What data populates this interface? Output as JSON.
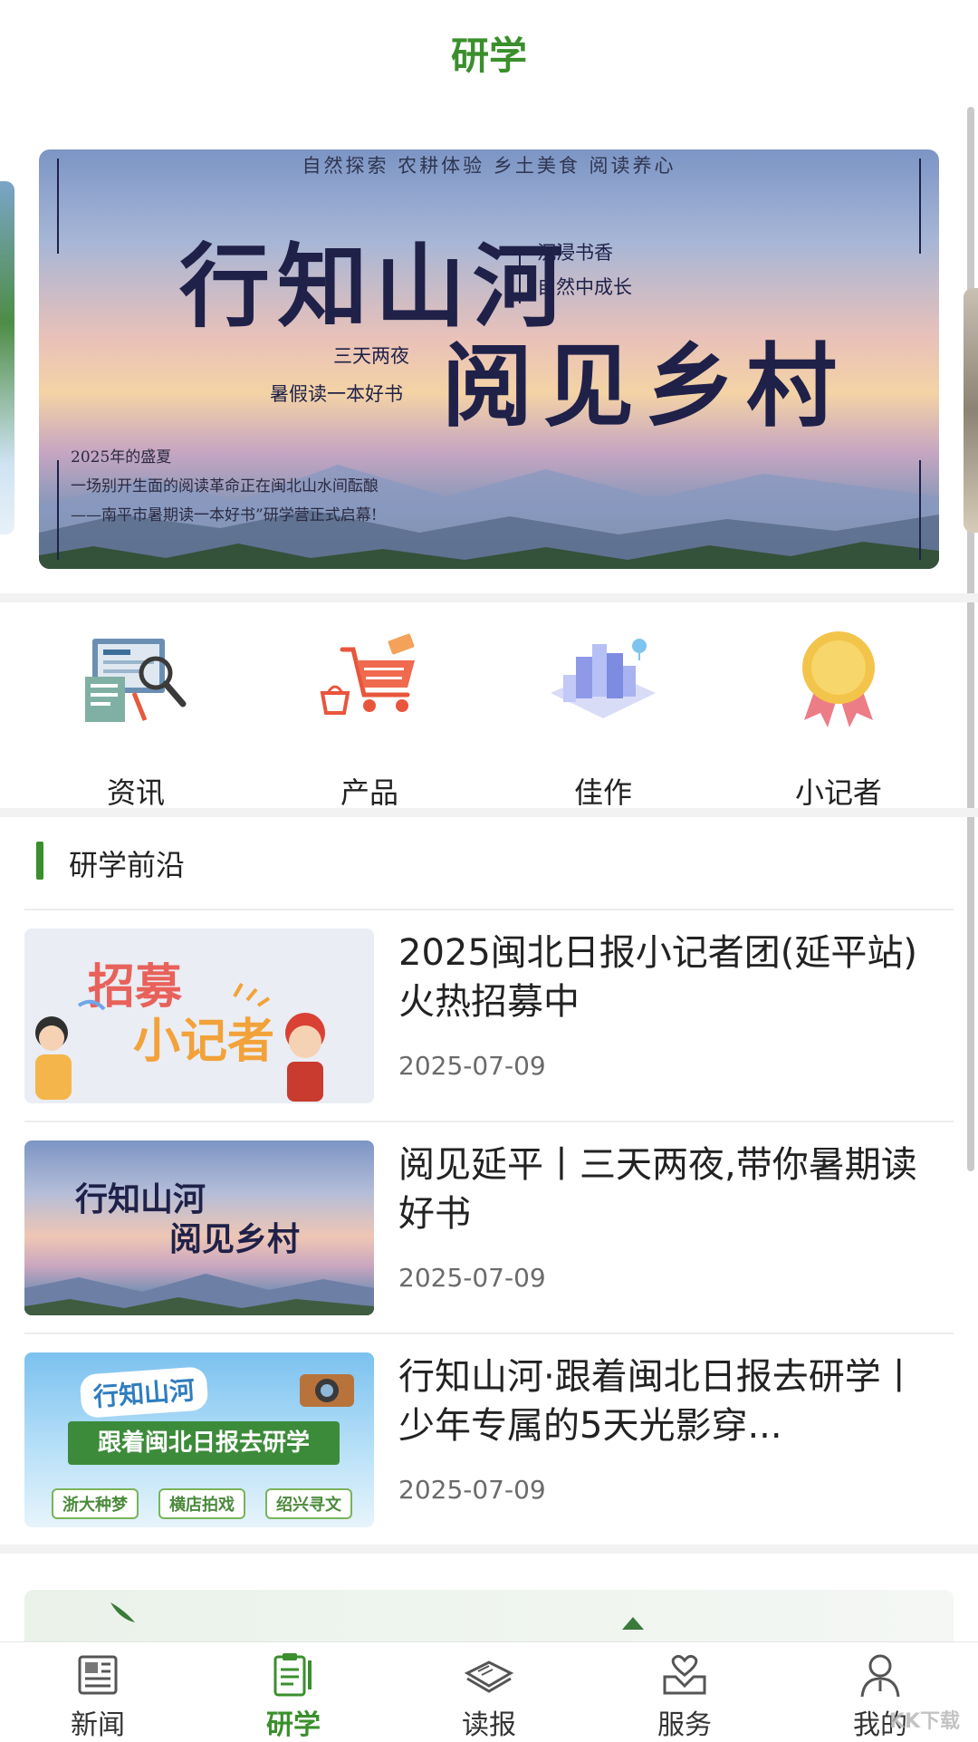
{
  "header": {
    "title": "研学"
  },
  "banner": {
    "tags": "自然探索  农耕体验  乡土美食  阅读养心",
    "title_line1": "行知山河",
    "sub1": "沉浸书香",
    "sub2": "自然中成长",
    "side1": "三天两夜",
    "side2": "暑假读一本好书",
    "title_line2": "阅见乡村",
    "foot1": "2025年的盛夏",
    "foot2": "一场别开生面的阅读革命正在闽北山水间酝酿",
    "foot3": "——南平市暑期读一本好书”研学营正式启幕!"
  },
  "quick_links": [
    {
      "label": "资讯",
      "icon": "news-document-icon"
    },
    {
      "label": "产品",
      "icon": "shopping-cart-icon"
    },
    {
      "label": "佳作",
      "icon": "city-buildings-icon"
    },
    {
      "label": "小记者",
      "icon": "medal-icon"
    }
  ],
  "section": {
    "title": "研学前沿"
  },
  "news": [
    {
      "title": "2025闽北日报小记者团(延平站)火热招募中",
      "date": "2025-07-09",
      "thumb": {
        "line1": "招募",
        "line2": "小记者"
      }
    },
    {
      "title": "阅见延平丨三天两夜,带你暑期读好书",
      "date": "2025-07-09",
      "thumb": {
        "line1": "行知山河",
        "line2": "阅见乡村"
      }
    },
    {
      "title": "行知山河·跟着闽北日报去研学丨少年专属的5天光影穿...",
      "date": "2025-07-09",
      "thumb": {
        "line1": "行知山河",
        "line2": "跟着闽北日报去研学",
        "tag1": "浙大种梦",
        "tag2": "横店拍戏",
        "tag3": "绍兴寻文"
      }
    }
  ],
  "tabbar": [
    {
      "label": "新闻",
      "icon": "newspaper-icon",
      "active": false
    },
    {
      "label": "研学",
      "icon": "clipboard-pencil-icon",
      "active": true
    },
    {
      "label": "读报",
      "icon": "open-book-icon",
      "active": false
    },
    {
      "label": "服务",
      "icon": "helping-hands-icon",
      "active": false
    },
    {
      "label": "我的",
      "icon": "person-icon",
      "active": false
    }
  ],
  "watermark": "KK下载",
  "colors": {
    "accent": "#3a8f2c",
    "text": "#222222",
    "date": "#6b6b6b"
  }
}
